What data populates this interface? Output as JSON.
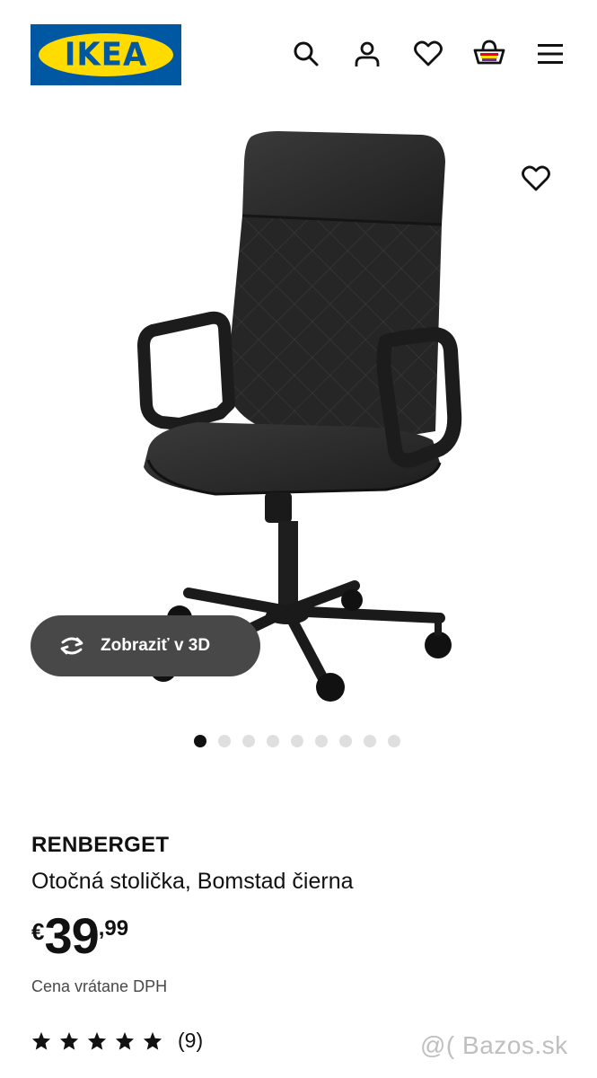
{
  "header": {
    "logo_text": "IKEA",
    "icons": [
      "search-icon",
      "user-icon",
      "heart-icon",
      "basket-icon",
      "menu-icon"
    ]
  },
  "gallery": {
    "view_3d_label": "Zobraziť v 3D",
    "image_count": 9,
    "active_index": 0
  },
  "product": {
    "name": "RENBERGET",
    "description": "Otočná stolička, Bomstad čierna",
    "price": {
      "currency": "€",
      "integer": "39",
      "decimal": ",99"
    },
    "vat_note": "Cena vrátane DPH",
    "rating": {
      "stars": 5,
      "count_label": "(9)"
    }
  },
  "watermark": "@( Bazos.sk",
  "colors": {
    "ikea_blue": "#0058a3",
    "ikea_yellow": "#ffdb00",
    "pill_bg": "#484848"
  }
}
